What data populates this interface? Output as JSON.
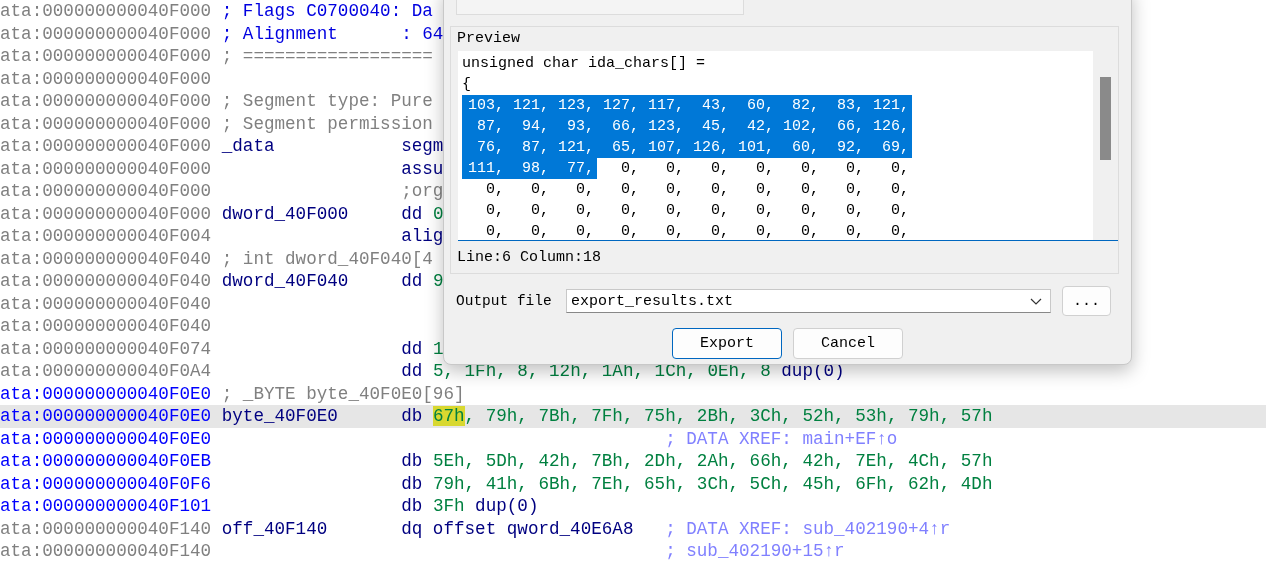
{
  "listing": {
    "lines": [
      {
        "address": "ata:000000000040F000",
        "color": "#808080",
        "selected": false,
        "kind": "header",
        "note": "; Flags C0700040: Da"
      },
      {
        "address": "ata:000000000040F000",
        "color": "#808080",
        "selected": false,
        "kind": "header",
        "note": "; Alignment      : 64"
      },
      {
        "address": "ata:000000000040F000",
        "color": "#808080",
        "selected": false,
        "kind": "comment",
        "note": "; =================="
      },
      {
        "address": "ata:000000000040F000",
        "color": "#808080",
        "selected": false,
        "kind": "blank"
      },
      {
        "address": "ata:000000000040F000",
        "color": "#808080",
        "selected": false,
        "kind": "comment",
        "note": "; Segment type: Pure"
      },
      {
        "address": "ata:000000000040F000",
        "color": "#808080",
        "selected": false,
        "kind": "comment",
        "note": "; Segment permission"
      },
      {
        "address": "ata:000000000040F000",
        "color": "#808080",
        "selected": false,
        "kind": "code",
        "label": "_data",
        "code": [
          {
            "text": "segm",
            "kind": "mnemonic"
          }
        ]
      },
      {
        "address": "ata:000000000040F000",
        "color": "#808080",
        "selected": false,
        "kind": "code",
        "code": [
          {
            "text": "assu",
            "kind": "mnemonic"
          }
        ]
      },
      {
        "address": "ata:000000000040F000",
        "color": "#808080",
        "selected": false,
        "kind": "code",
        "code": [
          {
            "text": ";org",
            "kind": "directive"
          }
        ]
      },
      {
        "address": "ata:000000000040F000",
        "color": "#808080",
        "selected": false,
        "kind": "code",
        "label": "dword_40F000",
        "code": [
          {
            "text": "dd ",
            "kind": "mnemonic"
          },
          {
            "text": "0",
            "kind": "number"
          }
        ]
      },
      {
        "address": "ata:000000000040F004",
        "color": "#808080",
        "selected": false,
        "kind": "code",
        "code": [
          {
            "text": "alig",
            "kind": "mnemonic"
          }
        ]
      },
      {
        "address": "ata:000000000040F040",
        "color": "#808080",
        "selected": false,
        "kind": "comment",
        "note": "; int dword_40F040[4"
      },
      {
        "address": "ata:000000000040F040",
        "color": "#808080",
        "selected": false,
        "kind": "code",
        "label": "dword_40F040",
        "code": [
          {
            "text": "dd ",
            "kind": "mnemonic"
          },
          {
            "text": "9",
            "kind": "number"
          }
        ]
      },
      {
        "address": "ata:000000000040F040",
        "color": "#808080",
        "selected": false,
        "kind": "blank"
      },
      {
        "address": "ata:000000000040F040",
        "color": "#808080",
        "selected": false,
        "kind": "blank"
      },
      {
        "address": "ata:000000000040F074",
        "color": "#808080",
        "selected": false,
        "kind": "code",
        "code": [
          {
            "text": "dd ",
            "kind": "mnemonic"
          },
          {
            "text": "1",
            "kind": "number"
          }
        ]
      },
      {
        "address": "ata:000000000040F0A4",
        "color": "#808080",
        "selected": false,
        "kind": "code",
        "code": [
          {
            "text": "dd ",
            "kind": "mnemonic"
          },
          {
            "text": "5, 1Fh, 8, 12h, 1Ah, 1Ch, 0Eh, 8 ",
            "kind": "number"
          },
          {
            "text": "dup(0)",
            "kind": "mnemonic"
          }
        ]
      },
      {
        "address": "ata:000000000040F0E0",
        "color": "#0000ff",
        "selected": false,
        "kind": "comment",
        "note": "; _BYTE byte_40F0E0[96]"
      },
      {
        "address": "ata:000000000040F0E0",
        "color": "#0000ff",
        "selected": true,
        "kind": "code",
        "label": "byte_40F0E0",
        "code": [
          {
            "text": "db ",
            "kind": "mnemonic"
          },
          {
            "text": "67h",
            "kind": "highlight"
          },
          {
            "text": ", 79h, 7Bh, 7Fh, 75h, 2Bh, 3Ch, 52h, 53h, 79h, 57h",
            "kind": "number"
          }
        ]
      },
      {
        "address": "ata:000000000040F0E0",
        "color": "#0000ff",
        "selected": false,
        "kind": "code",
        "xref": "; DATA XREF: main+EF↑o"
      },
      {
        "address": "ata:000000000040F0EB",
        "color": "#0000ff",
        "selected": false,
        "kind": "code",
        "code": [
          {
            "text": "db ",
            "kind": "mnemonic"
          },
          {
            "text": "5Eh, 5Dh, 42h, 7Bh, 2Dh, 2Ah, 66h, 42h, 7Eh, 4Ch, 57h",
            "kind": "number"
          }
        ]
      },
      {
        "address": "ata:000000000040F0F6",
        "color": "#0000ff",
        "selected": false,
        "kind": "code",
        "code": [
          {
            "text": "db ",
            "kind": "mnemonic"
          },
          {
            "text": "79h, 41h, 6Bh, 7Eh, 65h, 3Ch, 5Ch, 45h, 6Fh, 62h, 4Dh",
            "kind": "number"
          }
        ]
      },
      {
        "address": "ata:000000000040F101",
        "color": "#0000ff",
        "selected": false,
        "kind": "code",
        "code": [
          {
            "text": "db ",
            "kind": "mnemonic"
          },
          {
            "text": "3Fh ",
            "kind": "number"
          },
          {
            "text": "dup(0)",
            "kind": "mnemonic"
          }
        ]
      },
      {
        "address": "ata:000000000040F140",
        "color": "#808080",
        "selected": false,
        "kind": "code",
        "label": "off_40F140",
        "code": [
          {
            "text": "dq offset qword_40E6A8",
            "kind": "mnemonic"
          }
        ],
        "xref": "; DATA XREF: sub_402190+4↑r"
      },
      {
        "address": "ata:000000000040F140",
        "color": "#808080",
        "selected": false,
        "kind": "code",
        "xref": "; sub_402190+15↑r"
      }
    ]
  },
  "dialog": {
    "preview": {
      "title": "Preview",
      "header_lines": [
        "unsigned char ida_chars[] =",
        "{"
      ],
      "rows": [
        [
          {
            "text": "103,",
            "selected": true
          },
          {
            "text": "121,",
            "selected": true
          },
          {
            "text": "123,",
            "selected": true
          },
          {
            "text": "127,",
            "selected": true
          },
          {
            "text": "117,",
            "selected": true
          },
          {
            "text": "43,",
            "selected": true
          },
          {
            "text": "60,",
            "selected": true
          },
          {
            "text": "82,",
            "selected": true
          },
          {
            "text": "83,",
            "selected": true
          },
          {
            "text": "121,",
            "selected": true
          }
        ],
        [
          {
            "text": "87,",
            "selected": true
          },
          {
            "text": "94,",
            "selected": true
          },
          {
            "text": "93,",
            "selected": true
          },
          {
            "text": "66,",
            "selected": true
          },
          {
            "text": "123,",
            "selected": true
          },
          {
            "text": "45,",
            "selected": true
          },
          {
            "text": "42,",
            "selected": true
          },
          {
            "text": "102,",
            "selected": true
          },
          {
            "text": "66,",
            "selected": true
          },
          {
            "text": "126,",
            "selected": true
          }
        ],
        [
          {
            "text": "76,",
            "selected": true
          },
          {
            "text": "87,",
            "selected": true
          },
          {
            "text": "121,",
            "selected": true
          },
          {
            "text": "65,",
            "selected": true
          },
          {
            "text": "107,",
            "selected": true
          },
          {
            "text": "126,",
            "selected": true
          },
          {
            "text": "101,",
            "selected": true
          },
          {
            "text": "60,",
            "selected": true
          },
          {
            "text": "92,",
            "selected": true
          },
          {
            "text": "69,",
            "selected": true
          }
        ],
        [
          {
            "text": "111,",
            "selected": true
          },
          {
            "text": "98,",
            "selected": true
          },
          {
            "text": "77,",
            "selected": true
          },
          {
            "text": "0,",
            "selected": false
          },
          {
            "text": "0,",
            "selected": false
          },
          {
            "text": "0,",
            "selected": false
          },
          {
            "text": "0,",
            "selected": false
          },
          {
            "text": "0,",
            "selected": false
          },
          {
            "text": "0,",
            "selected": false
          },
          {
            "text": "0,",
            "selected": false
          }
        ],
        [
          {
            "text": "0,",
            "selected": false
          },
          {
            "text": "0,",
            "selected": false
          },
          {
            "text": "0,",
            "selected": false
          },
          {
            "text": "0,",
            "selected": false
          },
          {
            "text": "0,",
            "selected": false
          },
          {
            "text": "0,",
            "selected": false
          },
          {
            "text": "0,",
            "selected": false
          },
          {
            "text": "0,",
            "selected": false
          },
          {
            "text": "0,",
            "selected": false
          },
          {
            "text": "0,",
            "selected": false
          }
        ],
        [
          {
            "text": "0,",
            "selected": false
          },
          {
            "text": "0,",
            "selected": false
          },
          {
            "text": "0,",
            "selected": false
          },
          {
            "text": "0,",
            "selected": false
          },
          {
            "text": "0,",
            "selected": false
          },
          {
            "text": "0,",
            "selected": false
          },
          {
            "text": "0,",
            "selected": false
          },
          {
            "text": "0,",
            "selected": false
          },
          {
            "text": "0,",
            "selected": false
          },
          {
            "text": "0,",
            "selected": false
          }
        ],
        [
          {
            "text": "0,",
            "selected": false
          },
          {
            "text": "0,",
            "selected": false
          },
          {
            "text": "0,",
            "selected": false
          },
          {
            "text": "0,",
            "selected": false
          },
          {
            "text": "0,",
            "selected": false
          },
          {
            "text": "0,",
            "selected": false
          },
          {
            "text": "0,",
            "selected": false
          },
          {
            "text": "0,",
            "selected": false
          },
          {
            "text": "0,",
            "selected": false
          },
          {
            "text": "0,",
            "selected": false
          }
        ]
      ],
      "status": "Line:6  Column:18"
    },
    "output_file": {
      "label": "Output file",
      "value": "export_results.txt",
      "browse": "..."
    },
    "buttons": [
      {
        "label": "Export",
        "default": true
      },
      {
        "label": "Cancel",
        "default": false
      }
    ]
  }
}
